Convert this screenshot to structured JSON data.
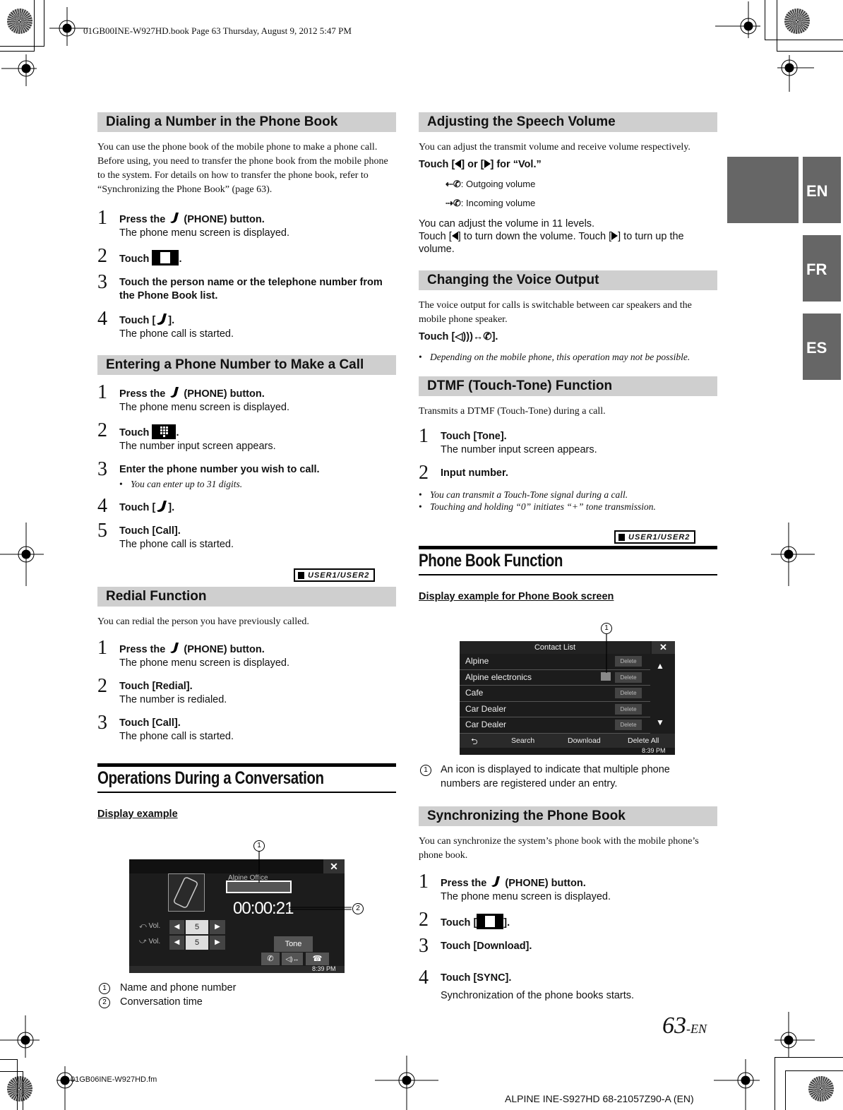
{
  "print_meta": {
    "header": "01GB00INE-W927HD.book  Page 63  Thursday, August 9, 2012  5:47 PM",
    "footer_file": "01GB06INE-W927HD.fm",
    "footer_model": "ALPINE INE-S927HD 68-21057Z90-A (EN)"
  },
  "language_tabs": [
    "EN",
    "FR",
    "ES"
  ],
  "page_number": {
    "number": "63",
    "suffix": "-EN"
  },
  "badge_label": "USER1/USER2",
  "left": {
    "dialing": {
      "title": "Dialing a Number in the Phone Book",
      "intro": "You can use the phone book of the mobile phone to make a phone call. Before using, you need to transfer the phone book from the mobile phone to the system. For details on how to transfer the phone book, refer to “Synchronizing the Phone Book” (page 63).",
      "steps": [
        {
          "num": "1",
          "pre": "Press the",
          "post": "(PHONE) button.",
          "result": "The phone menu screen is displayed."
        },
        {
          "num": "2",
          "pre": "Touch",
          "post": "."
        },
        {
          "num": "3",
          "text": "Touch the person name or the telephone number from the Phone Book list."
        },
        {
          "num": "4",
          "pre": "Touch [",
          "post": "].",
          "result": "The phone call is started."
        }
      ]
    },
    "entering": {
      "title": "Entering a Phone Number to Make a Call",
      "steps": [
        {
          "num": "1",
          "pre": "Press the",
          "post": "(PHONE) button.",
          "result": "The phone menu screen is displayed."
        },
        {
          "num": "2",
          "pre": "Touch",
          "post": ".",
          "result": "The number input screen appears."
        },
        {
          "num": "3",
          "text": "Enter the phone number you wish to call.",
          "note": "You can enter up to 31 digits."
        },
        {
          "num": "4",
          "pre": "Touch [",
          "post": "]."
        },
        {
          "num": "5",
          "text": "Touch [Call].",
          "result": "The phone call is started."
        }
      ]
    },
    "redial": {
      "title": "Redial Function",
      "intro": "You can redial the person you have previously called.",
      "steps": [
        {
          "num": "1",
          "pre": "Press the",
          "post": "(PHONE) button.",
          "result": "The phone menu screen is displayed."
        },
        {
          "num": "2",
          "text": "Touch [Redial].",
          "result": "The number is redialed."
        },
        {
          "num": "3",
          "text": "Touch [Call].",
          "result": "The phone call is started."
        }
      ]
    },
    "operations": {
      "title": "Operations During a Conversation",
      "subtitle": "Display example",
      "screen": {
        "caller_name": "Alpine Office",
        "timer": "00:00:21",
        "vol_label": "Vol.",
        "vol_out": "5",
        "vol_in": "5",
        "tone_button": "Tone",
        "clock": "8:39 PM",
        "close": "✕"
      },
      "callouts": [
        {
          "num": "1",
          "text": "Name and phone number"
        },
        {
          "num": "2",
          "text": "Conversation time"
        }
      ]
    }
  },
  "right": {
    "speech_volume": {
      "title": "Adjusting the Speech Volume",
      "intro": "You can adjust the transmit volume and receive volume respectively.",
      "instruction_pre": "Touch [",
      "instruction_mid": "] or [",
      "instruction_post": "] for “Vol.”",
      "legend": [
        {
          "icon": "outgoing-volume-icon",
          "text": ": Outgoing volume"
        },
        {
          "icon": "incoming-volume-icon",
          "text": ": Incoming volume"
        }
      ],
      "levels_text": "You can adjust the volume in 11 levels.",
      "detail_pre": "Touch [",
      "detail_mid": "] to turn down the volume. Touch [",
      "detail_post": "] to turn up the volume."
    },
    "voice_output": {
      "title": "Changing the Voice Output",
      "intro": "The voice output for calls is switchable between car speakers and the mobile phone speaker.",
      "instruction_pre": "Touch [",
      "instruction_post": "].",
      "note": "Depending on the mobile phone, this operation may not be possible."
    },
    "dtmf": {
      "title": "DTMF (Touch-Tone) Function",
      "intro": "Transmits a DTMF (Touch-Tone) during a call.",
      "steps": [
        {
          "num": "1",
          "text": "Touch [Tone].",
          "result": "The number input screen appears."
        },
        {
          "num": "2",
          "text": "Input number."
        }
      ],
      "notes": [
        "You can transmit a Touch-Tone signal during a call.",
        "Touching and holding “0” initiates “+” tone transmission."
      ]
    },
    "phone_book": {
      "title": "Phone Book Function",
      "subtitle": "Display example for Phone Book screen",
      "screen": {
        "title": "Contact List",
        "contacts": [
          "Alpine",
          "Alpine electronics",
          "Cafe",
          "Car Dealer",
          "Car Dealer"
        ],
        "delete_label": "Delete",
        "buttons": [
          "Search",
          "Download",
          "Delete All"
        ],
        "clock": "8:39 PM",
        "close": "✕"
      },
      "callout": {
        "num": "1",
        "text": "An icon is displayed to indicate that multiple phone numbers are registered under an entry."
      }
    },
    "sync": {
      "title": "Synchronizing the Phone Book",
      "intro": "You can synchronize the system’s phone book with the mobile phone’s phone book.",
      "steps": [
        {
          "num": "1",
          "pre": "Press the",
          "post": "(PHONE) button.",
          "result": "The phone menu screen is displayed."
        },
        {
          "num": "2",
          "pre": "Touch [",
          "post": "]."
        },
        {
          "num": "3",
          "text": "Touch [Download]."
        },
        {
          "num": "4",
          "text": "Touch [SYNC].",
          "result": "Synchronization of the phone books starts."
        }
      ]
    }
  }
}
